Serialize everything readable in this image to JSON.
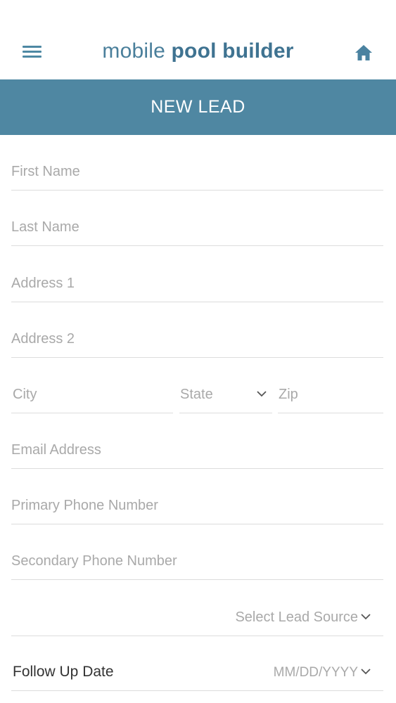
{
  "header": {
    "brand_light": "mobile",
    "brand_bold": "pool builder"
  },
  "title_bar": {
    "title": "NEW LEAD"
  },
  "form": {
    "first_name": "First Name",
    "last_name": "Last Name",
    "address1": "Address 1",
    "address2": "Address 2",
    "city": "City",
    "state": "State",
    "zip": "Zip",
    "email": "Email Address",
    "primary_phone": "Primary Phone Number",
    "secondary_phone": "Secondary Phone Number",
    "lead_source": "Select Lead Source",
    "follow_up_label": "Follow Up Date",
    "follow_up_placeholder": "MM/DD/YYYY"
  },
  "colors": {
    "accent": "#4f87a2",
    "placeholder": "#a9a9a9",
    "divider": "#dcdcdc"
  },
  "icons": {
    "menu": "hamburger-menu-icon",
    "home": "home-icon",
    "dropdown": "chevron-down-icon"
  }
}
